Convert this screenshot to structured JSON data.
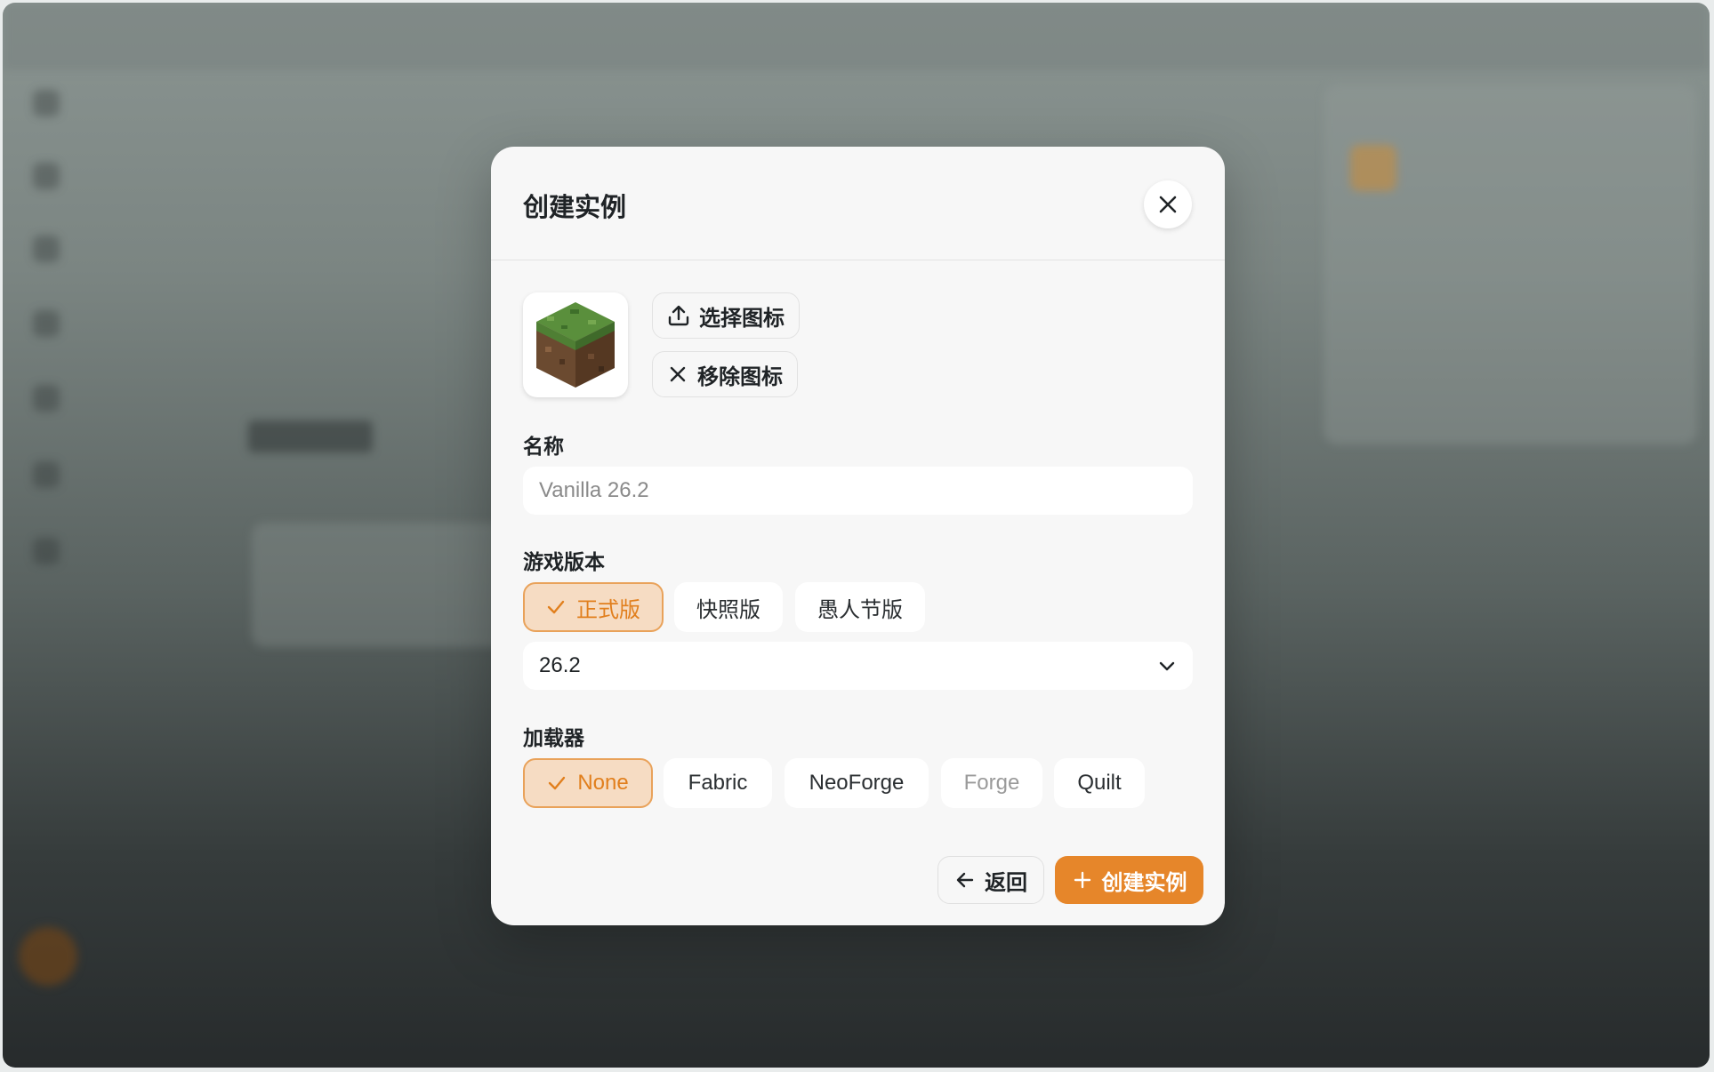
{
  "modal": {
    "title": "创建实例",
    "select_icon_label": "选择图标",
    "remove_icon_label": "移除图标",
    "name_label": "名称",
    "name_placeholder": "Vanilla 26.2",
    "name_value": "",
    "game_version_label": "游戏版本",
    "version_types": [
      {
        "label": "正式版",
        "selected": true
      },
      {
        "label": "快照版",
        "selected": false
      },
      {
        "label": "愚人节版",
        "selected": false
      }
    ],
    "version_selected": "26.2",
    "loader_label": "加载器",
    "loaders": [
      {
        "label": "None",
        "selected": true,
        "disabled": false
      },
      {
        "label": "Fabric",
        "selected": false,
        "disabled": false
      },
      {
        "label": "NeoForge",
        "selected": false,
        "disabled": false
      },
      {
        "label": "Forge",
        "selected": false,
        "disabled": true
      },
      {
        "label": "Quilt",
        "selected": false,
        "disabled": false
      }
    ],
    "back_label": "返回",
    "create_label": "创建实例"
  },
  "icons": {
    "close": "close-icon",
    "upload": "upload-icon",
    "remove": "x-icon",
    "check": "check-icon",
    "dropdown": "chevron-down-icon",
    "back": "arrow-left-icon",
    "create": "plus-icon",
    "instance": "grass-block-icon"
  },
  "colors": {
    "accent": "#e6862a",
    "accent_soft": "#f6dcc3",
    "accent_text": "#e17f1d",
    "modal_bg": "#f7f7f7"
  }
}
